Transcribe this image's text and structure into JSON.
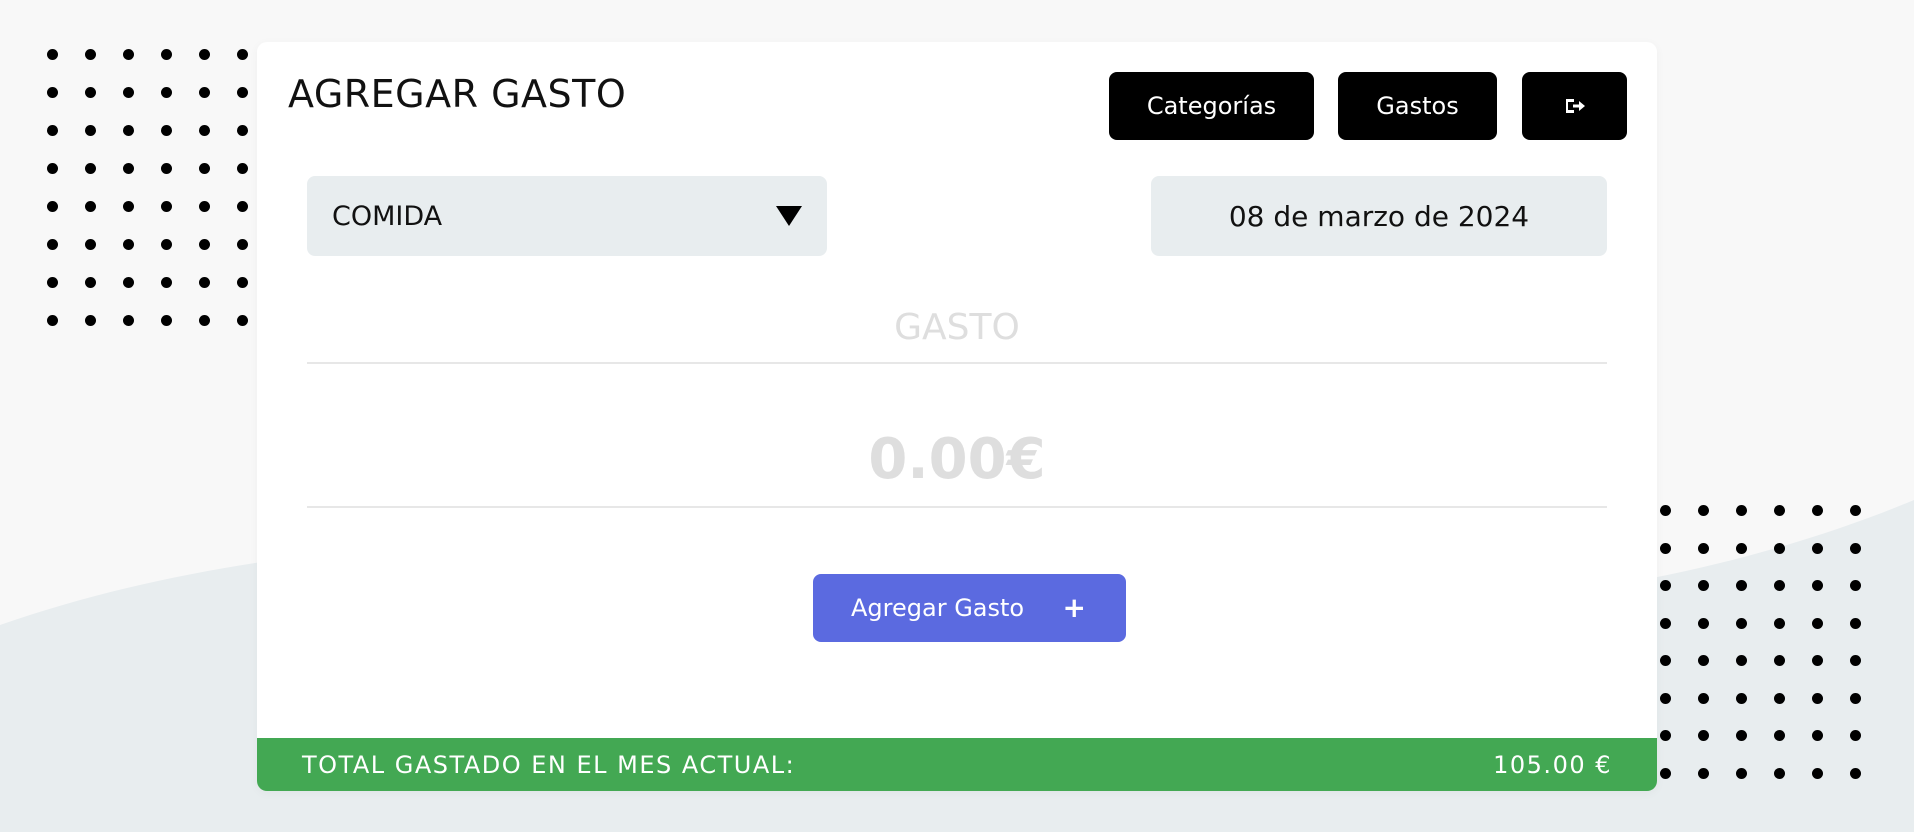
{
  "header": {
    "title": "AGREGAR GASTO",
    "nav": {
      "categorias_label": "Categorías",
      "gastos_label": "Gastos",
      "logout_icon": "logout-icon"
    }
  },
  "form": {
    "category": {
      "selected": "COMIDA",
      "icon": "triangle-down-icon"
    },
    "date": "08 de marzo de 2024",
    "description": {
      "value": "",
      "placeholder": "GASTO"
    },
    "amount": {
      "value": "",
      "placeholder": "0.00€"
    },
    "submit": {
      "label": "Agregar Gasto",
      "icon_text": "+"
    }
  },
  "footer": {
    "label": "TOTAL GASTADO EN EL MES ACTUAL:",
    "total": "105.00 €"
  },
  "colors": {
    "background": "#f8f8f8",
    "wave": "#e8edef",
    "primary": "#5b6ae0",
    "success": "#43a853",
    "field": "#e8edef",
    "nav_button": "#000000"
  }
}
